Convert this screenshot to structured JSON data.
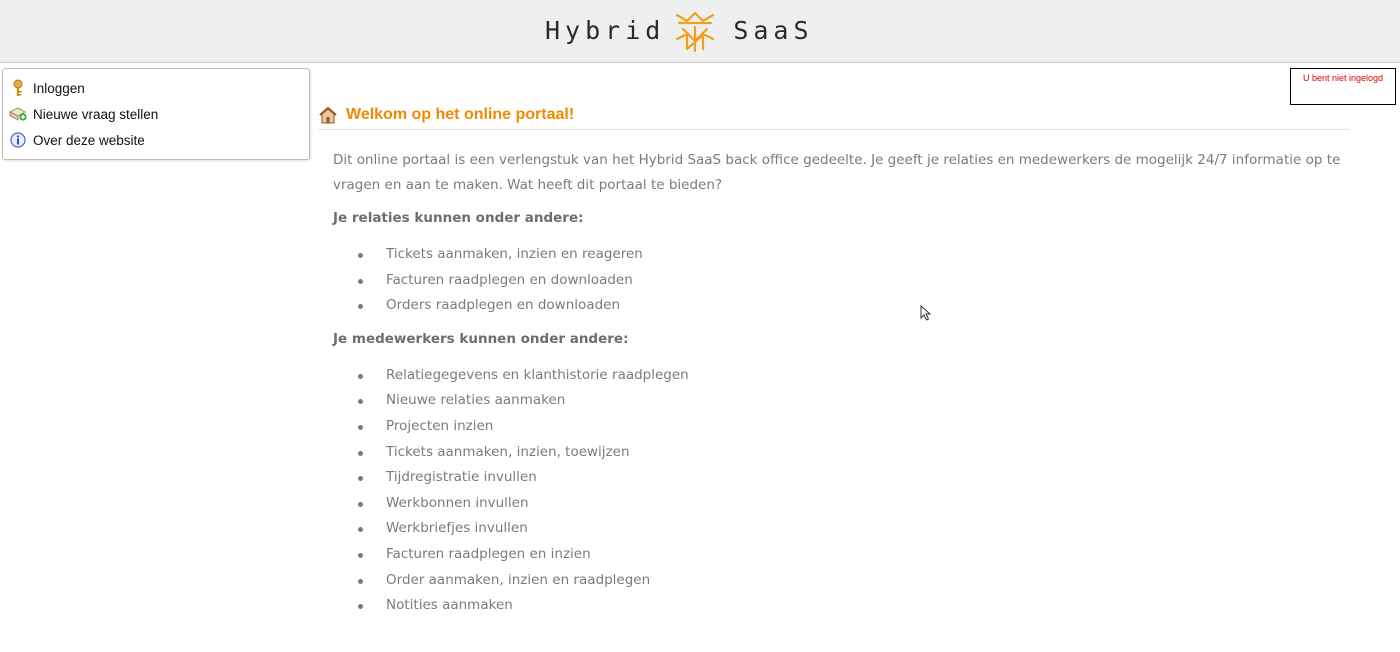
{
  "header": {
    "logo_left": "Hybrid",
    "logo_right": "SaaS",
    "brand_color": "#f0a020"
  },
  "sidebar": {
    "items": [
      {
        "label": "Inloggen",
        "icon": "key-icon"
      },
      {
        "label": "Nieuwe vraag stellen",
        "icon": "new-question-icon"
      },
      {
        "label": "Over deze website",
        "icon": "info-icon"
      }
    ]
  },
  "status": {
    "login_text": "U bent niet ingelogd",
    "color": "#e00000"
  },
  "main": {
    "title": "Welkom op het online portaal!",
    "title_color": "#f08a00",
    "intro": "Dit online portaal is een verlengstuk van het Hybrid SaaS back office gedeelte. Je geeft je relaties en medewerkers de mogelijk 24/7 informatie op te vragen en aan te maken. Wat heeft dit portaal te bieden?",
    "relations_heading": "Je relaties kunnen onder andere:",
    "relations_items": [
      "Tickets aanmaken, inzien en reageren",
      "Facturen raadplegen en downloaden",
      "Orders raadplegen en downloaden"
    ],
    "employees_heading": "Je medewerkers kunnen onder andere:",
    "employees_items": [
      "Relatiegegevens en klanthistorie raadplegen",
      "Nieuwe relaties aanmaken",
      "Projecten inzien",
      "Tickets aanmaken, inzien, toewijzen",
      "Tijdregistratie invullen",
      "Werkbonnen invullen",
      "Werkbriefjes invullen",
      "Facturen raadplegen en inzien",
      "Order aanmaken, inzien en raadplegen",
      "Notities aanmaken"
    ]
  }
}
